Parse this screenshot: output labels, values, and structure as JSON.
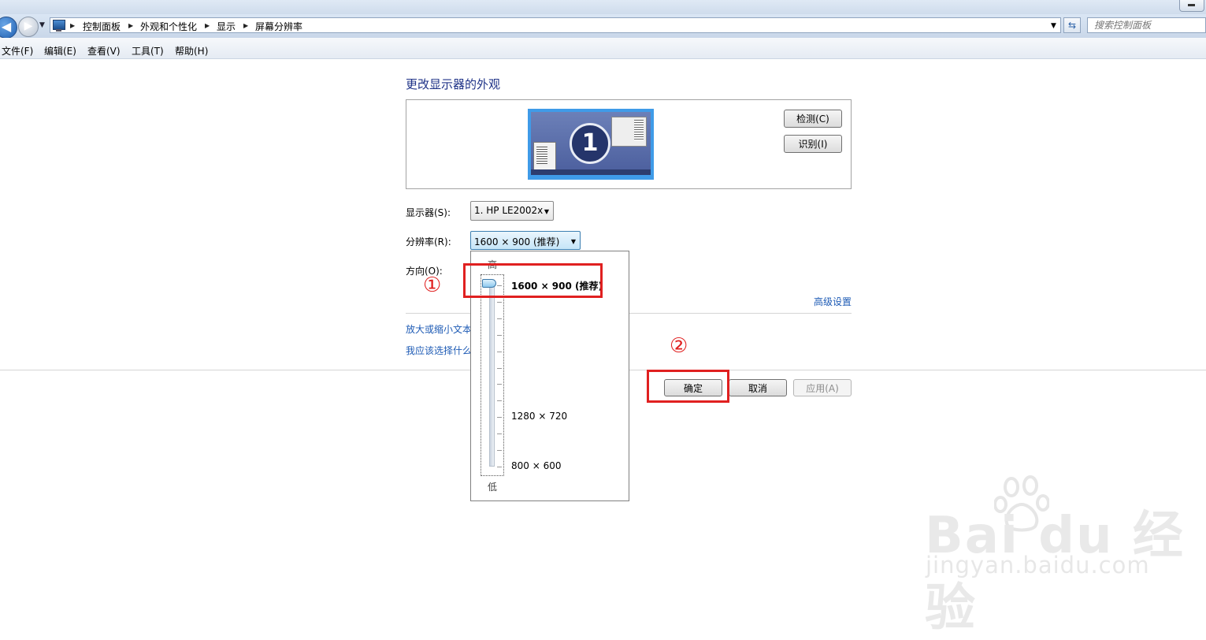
{
  "breadcrumb": [
    "控制面板",
    "外观和个性化",
    "显示",
    "屏幕分辨率"
  ],
  "search": {
    "placeholder": "搜索控制面板"
  },
  "menu": [
    "文件(F)",
    "编辑(E)",
    "查看(V)",
    "工具(T)",
    "帮助(H)"
  ],
  "page": {
    "heading": "更改显示器的外观",
    "detect_label": "检测(C)",
    "identify_label": "识别(I)",
    "monitor_number": "1",
    "display_label": "显示器(S):",
    "display_value": "1. HP LE2002x",
    "resolution_label": "分辨率(R):",
    "resolution_value": "1600 × 900 (推荐)",
    "orientation_label": "方向(O):",
    "advanced_link": "高级设置",
    "link_text_size": "放大或缩小文本",
    "link_which": "我应该选择什么"
  },
  "dropdown": {
    "high_label": "高",
    "low_label": "低",
    "selected": "1600 × 900 (推荐)",
    "mid": "1280 × 720",
    "bottom": "800 × 600",
    "slider_level": 1.0
  },
  "buttons": {
    "ok": "确定",
    "cancel": "取消",
    "apply": "应用(A)"
  },
  "annotations": {
    "step1": "①",
    "step2": "②"
  },
  "watermark": {
    "brand": "Bai du 经验",
    "url": "jingyan.baidu.com"
  }
}
